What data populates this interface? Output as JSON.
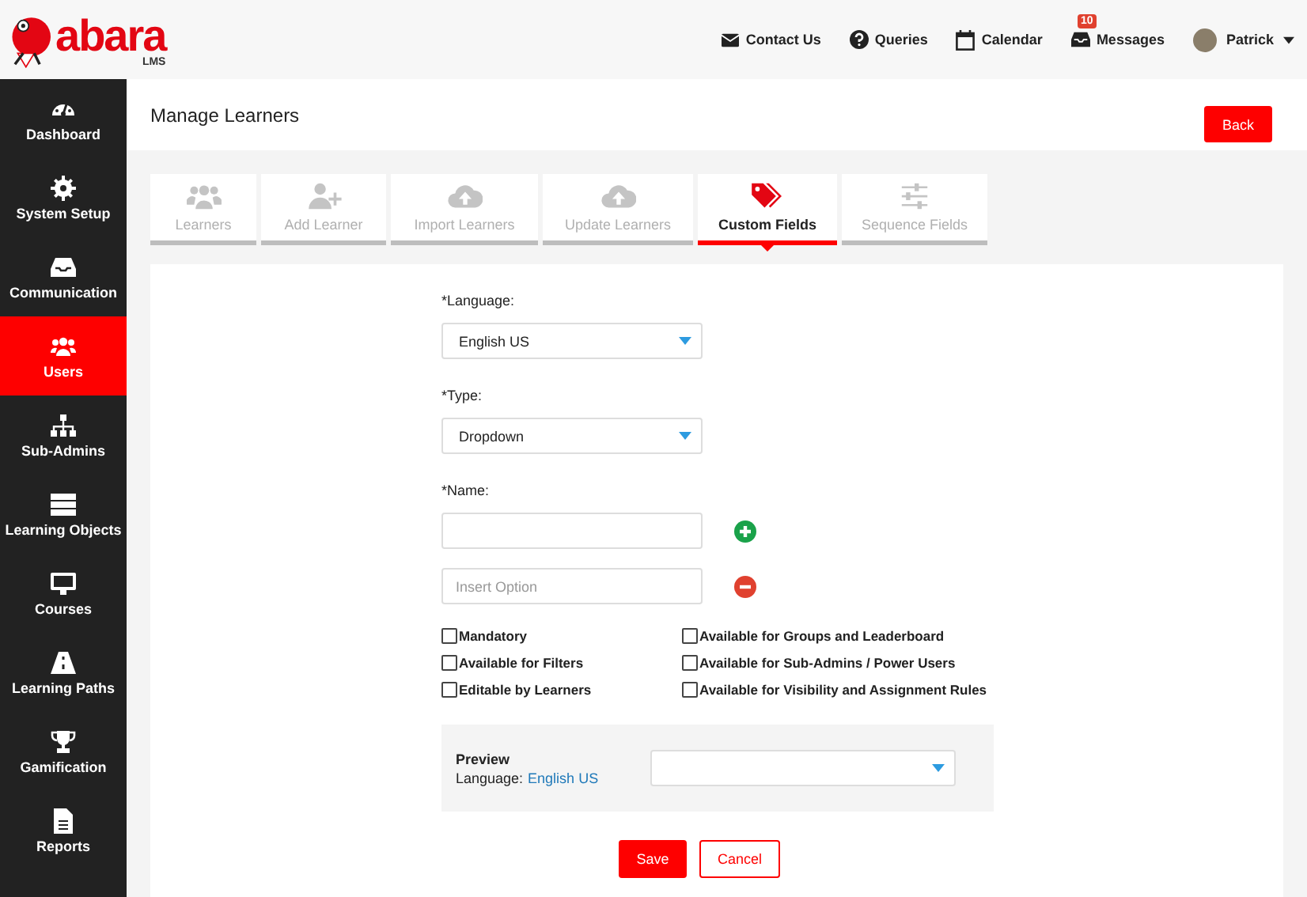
{
  "header": {
    "logo": {
      "name": "abara",
      "sub": "LMS"
    },
    "nav": [
      {
        "label": "Contact Us",
        "kind": "envelope"
      },
      {
        "label": "Queries",
        "kind": "question"
      },
      {
        "label": "Calendar",
        "kind": "calendar"
      },
      {
        "label": "Messages",
        "kind": "inbox",
        "badge": "10"
      }
    ],
    "user": "Patrick"
  },
  "sidebar": {
    "items": [
      {
        "label": "Dashboard",
        "kind": "gauge",
        "selected": false
      },
      {
        "label": "System Setup",
        "kind": "gear",
        "selected": false
      },
      {
        "label": "Communication",
        "kind": "inbox",
        "selected": false
      },
      {
        "label": "Users",
        "kind": "users",
        "selected": true
      },
      {
        "label": "Sub-Admins",
        "kind": "sitemap",
        "selected": false
      },
      {
        "label": "Learning Objects",
        "kind": "server",
        "selected": false
      },
      {
        "label": "Courses",
        "kind": "monitor",
        "selected": false
      },
      {
        "label": "Learning Paths",
        "kind": "road",
        "selected": false
      },
      {
        "label": "Gamification",
        "kind": "trophy",
        "selected": false
      },
      {
        "label": "Reports",
        "kind": "file",
        "selected": false
      }
    ]
  },
  "page": {
    "title": "Manage Learners",
    "back": "Back"
  },
  "tabs": [
    {
      "label": "Learners",
      "kind": "users",
      "selected": false
    },
    {
      "label": "Add Learner",
      "kind": "user-plus",
      "selected": false
    },
    {
      "label": "Import Learners",
      "kind": "cloud",
      "selected": false
    },
    {
      "label": "Update Learners",
      "kind": "cloud",
      "selected": false
    },
    {
      "label": "Custom Fields",
      "kind": "tags",
      "selected": true
    },
    {
      "label": "Sequence Fields",
      "kind": "sliders",
      "selected": false
    }
  ],
  "form": {
    "language": {
      "label": "*Language:",
      "value": "English US"
    },
    "type": {
      "label": "*Type:",
      "value": "Dropdown"
    },
    "name": {
      "label": "*Name:"
    },
    "option": {
      "placeholder": "Insert Option"
    },
    "checkboxes_left": [
      {
        "label": "Mandatory",
        "checked": false
      },
      {
        "label": "Available for Filters",
        "checked": false
      },
      {
        "label": "Editable by Learners",
        "checked": false
      }
    ],
    "checkboxes_right": [
      {
        "label": "Available for Groups and Leaderboard",
        "checked": false
      },
      {
        "label": "Available for Sub-Admins / Power Users",
        "checked": false
      },
      {
        "label": "Available for Visibility and Assignment Rules",
        "checked": false
      }
    ],
    "preview": {
      "title": "Preview",
      "language_label": "Language:",
      "language": "English US"
    },
    "save": "Save",
    "cancel": "Cancel"
  }
}
